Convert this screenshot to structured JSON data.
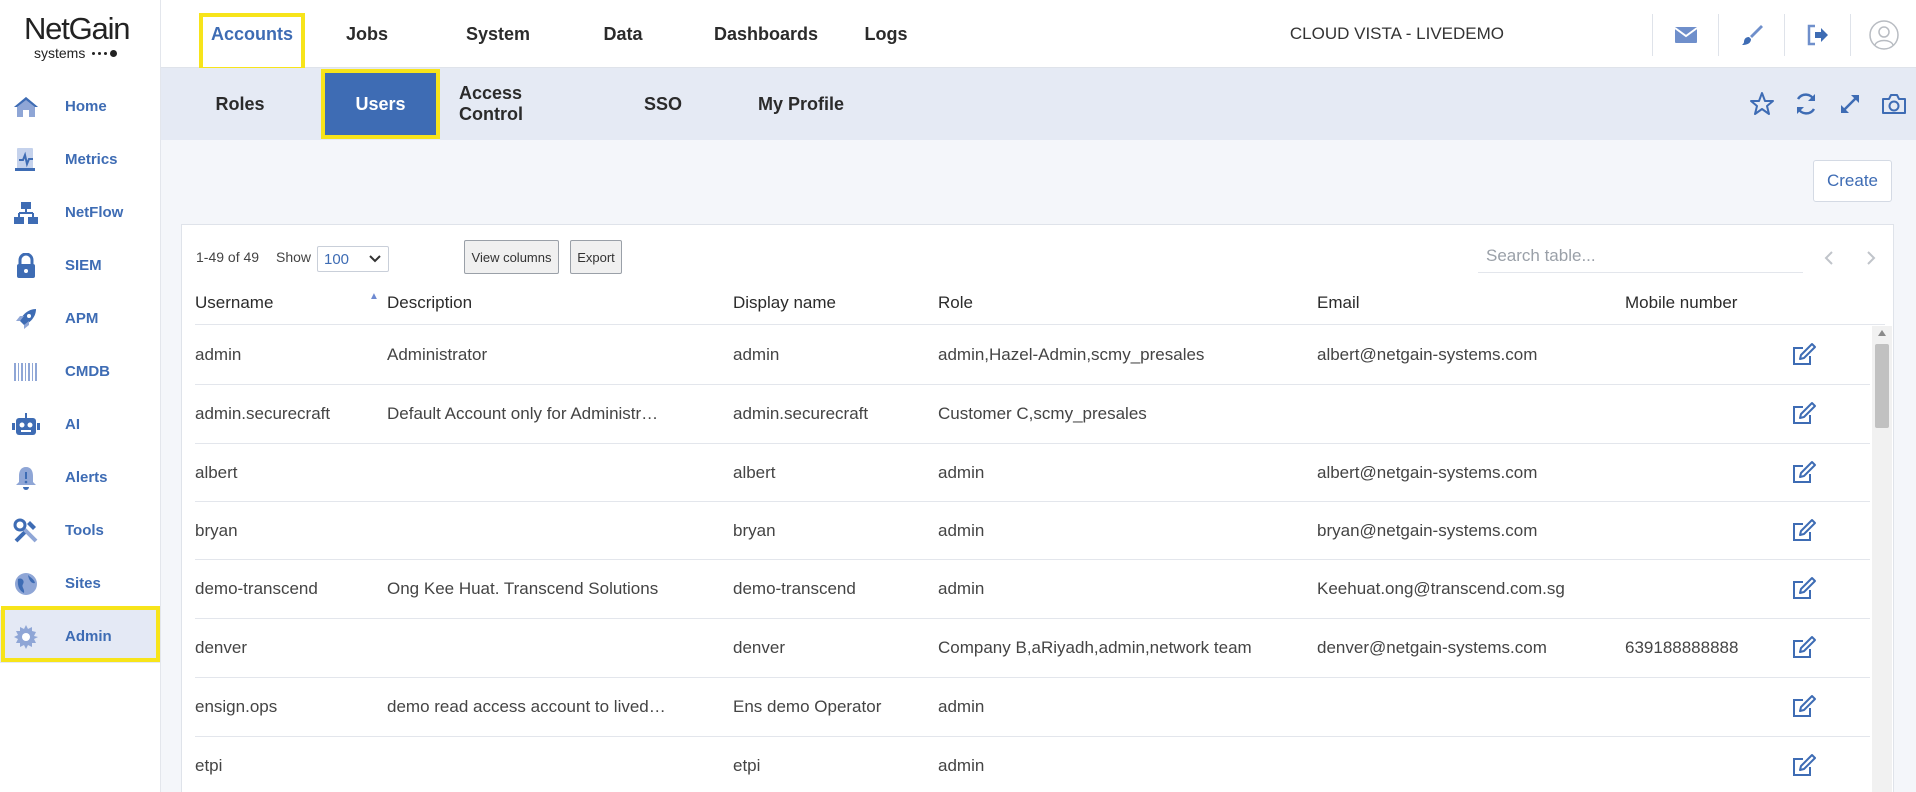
{
  "brand": {
    "name": "NetGain",
    "sub": "systems"
  },
  "sidebar": {
    "items": [
      {
        "label": "Home",
        "icon": "home-icon"
      },
      {
        "label": "Metrics",
        "icon": "metrics-icon"
      },
      {
        "label": "NetFlow",
        "icon": "netflow-icon"
      },
      {
        "label": "SIEM",
        "icon": "lock-icon"
      },
      {
        "label": "APM",
        "icon": "rocket-icon"
      },
      {
        "label": "CMDB",
        "icon": "barcode-icon"
      },
      {
        "label": "AI",
        "icon": "robot-icon"
      },
      {
        "label": "Alerts",
        "icon": "bell-icon"
      },
      {
        "label": "Tools",
        "icon": "tools-icon"
      },
      {
        "label": "Sites",
        "icon": "globe-icon"
      },
      {
        "label": "Admin",
        "icon": "gear-icon"
      }
    ],
    "active": "Admin"
  },
  "topnav": {
    "items": [
      "Accounts",
      "Jobs",
      "System",
      "Data",
      "Dashboards",
      "Logs"
    ],
    "active": "Accounts",
    "tenant": "CLOUD VISTA - LIVEDEMO",
    "icons": [
      "mail-icon",
      "brush-icon",
      "logout-icon",
      "user-avatar-icon"
    ]
  },
  "subnav": {
    "items": [
      "Roles",
      "Users",
      "Access Control",
      "SSO",
      "My Profile"
    ],
    "active": "Users",
    "icons": [
      "star-icon",
      "refresh-icon",
      "expand-icon",
      "camera-icon"
    ]
  },
  "actions": {
    "create_label": "Create"
  },
  "table": {
    "count": "1-49 of 49",
    "show_label": "Show",
    "page_size": "100",
    "view_columns_label": "View columns",
    "export_label": "Export",
    "search_placeholder": "Search table...",
    "columns": [
      "Username",
      "Description",
      "Display name",
      "Role",
      "Email",
      "Mobile number"
    ],
    "sort_column": "Username",
    "rows": [
      {
        "username": "admin",
        "description": "Administrator",
        "display_name": "admin",
        "role": "admin,Hazel-Admin,scmy_presales",
        "email": "albert@netgain-systems.com",
        "mobile": ""
      },
      {
        "username": "admin.securecraft",
        "description": "Default Account only for Administr…",
        "display_name": "admin.securecraft",
        "role": "Customer C,scmy_presales",
        "email": "",
        "mobile": ""
      },
      {
        "username": "albert",
        "description": "",
        "display_name": "albert",
        "role": "admin",
        "email": "albert@netgain-systems.com",
        "mobile": ""
      },
      {
        "username": "bryan",
        "description": "",
        "display_name": "bryan",
        "role": "admin",
        "email": "bryan@netgain-systems.com",
        "mobile": ""
      },
      {
        "username": "demo-transcend",
        "description": "Ong Kee Huat. Transcend Solutions",
        "display_name": "demo-transcend",
        "role": "admin",
        "email": "Keehuat.ong@transcend.com.sg",
        "mobile": ""
      },
      {
        "username": "denver",
        "description": "",
        "display_name": "denver",
        "role": "Company B,aRiyadh,admin,network team",
        "email": "denver@netgain-systems.com",
        "mobile": "639188888888"
      },
      {
        "username": "ensign.ops",
        "description": "demo read access account to lived…",
        "display_name": "Ens demo Operator",
        "role": "admin",
        "email": "",
        "mobile": ""
      },
      {
        "username": "etpi",
        "description": "",
        "display_name": "etpi",
        "role": "admin",
        "email": "",
        "mobile": ""
      }
    ]
  },
  "colors": {
    "accent": "#3e6cb4",
    "highlight": "#f7e41a",
    "subbar_bg": "#e5eaf4",
    "content_bg": "#f4f6fa"
  }
}
